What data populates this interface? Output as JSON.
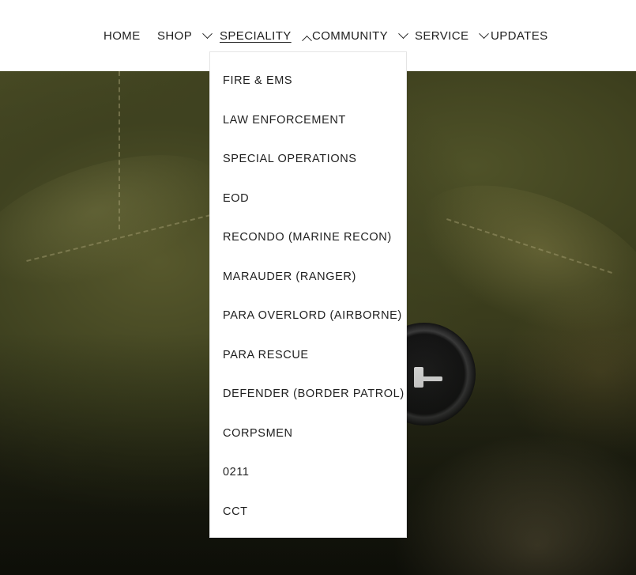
{
  "nav": {
    "items": [
      {
        "label": "HOME",
        "has_dropdown": false
      },
      {
        "label": "SHOP",
        "has_dropdown": true
      },
      {
        "label": "SPECIALITY",
        "has_dropdown": true,
        "active": true,
        "expanded": true
      },
      {
        "label": "COMMUNITY",
        "has_dropdown": true
      },
      {
        "label": "SERVICE",
        "has_dropdown": true
      },
      {
        "label": "UPDATES",
        "has_dropdown": false
      }
    ]
  },
  "speciality_menu": {
    "items": [
      {
        "label": "FIRE & EMS",
        "highlighted": false
      },
      {
        "label": "LAW ENFORCEMENT",
        "highlighted": false
      },
      {
        "label": "SPECIAL OPERATIONS",
        "highlighted": false
      },
      {
        "label": "EOD",
        "highlighted": false
      },
      {
        "label": "RECONDO (MARINE RECON)",
        "highlighted": false
      },
      {
        "label": "MARAUDER (RANGER)",
        "highlighted": false
      },
      {
        "label": "PARA OVERLORD (AIRBORNE)",
        "highlighted": false
      },
      {
        "label": "PARA RESCUE",
        "highlighted": true
      },
      {
        "label": "DEFENDER (BORDER PATROL)",
        "highlighted": false
      },
      {
        "label": "CORPSMEN",
        "highlighted": true
      },
      {
        "label": "0211",
        "highlighted": false
      },
      {
        "label": "CCT",
        "highlighted": true
      }
    ]
  },
  "icons": {
    "dropdown_closed": "chevron-down-icon",
    "dropdown_open": "chevron-up-icon"
  },
  "colors": {
    "highlight_border": "#d93a1f",
    "text": "#1f1f1f",
    "background": "#ffffff"
  }
}
